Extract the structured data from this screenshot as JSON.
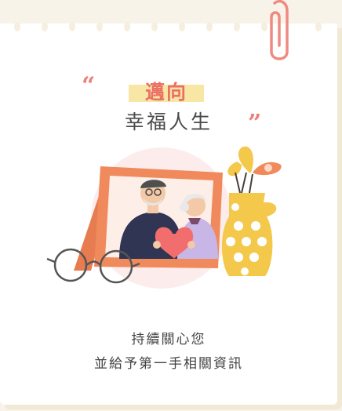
{
  "title": {
    "highlight": "邁向",
    "subtitle": "幸福人生",
    "open_quote": "“",
    "close_quote": "”"
  },
  "message": {
    "line1": "持續關心您",
    "line2": "並給予第一手相關資訊"
  },
  "icons": [
    "paperclip-icon",
    "photo-frame-illustration",
    "elderly-couple-illustration",
    "heart-icon",
    "flower-vase-illustration",
    "eyeglasses-icon"
  ],
  "colors": {
    "accent": "#ec6f66",
    "highlight": "#f7e6a4",
    "frame": "#f08a5d",
    "vase": "#f3c84b",
    "background": "#f8f3e8"
  }
}
